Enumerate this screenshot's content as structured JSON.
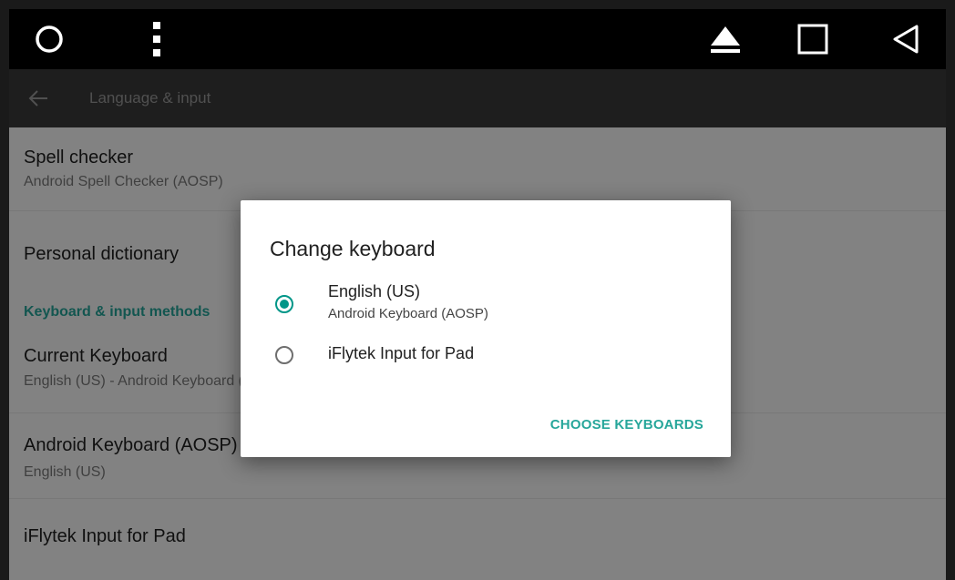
{
  "appbar": {
    "title": "Language & input"
  },
  "list": {
    "spell_checker": {
      "title": "Spell checker",
      "subtitle": "Android Spell Checker (AOSP)"
    },
    "personal_dictionary": {
      "title": "Personal dictionary"
    },
    "section_header": "Keyboard & input methods",
    "current_keyboard": {
      "title": "Current Keyboard",
      "subtitle": "English (US) - Android Keyboard (AOSP)"
    },
    "android_keyboard": {
      "title": "Android Keyboard (AOSP)",
      "subtitle": "English (US)"
    },
    "iflytek": {
      "title": "iFlytek Input for Pad"
    }
  },
  "dialog": {
    "title": "Change keyboard",
    "options": [
      {
        "label": "English (US)",
        "sublabel": "Android Keyboard (AOSP)",
        "selected": true
      },
      {
        "label": "iFlytek Input for Pad",
        "selected": false
      }
    ],
    "action": "CHOOSE KEYBOARDS"
  },
  "colors": {
    "accent": "#009688",
    "accent_text": "#26a69a",
    "sysbar": "#000000",
    "appbar": "#3a3a3a"
  }
}
